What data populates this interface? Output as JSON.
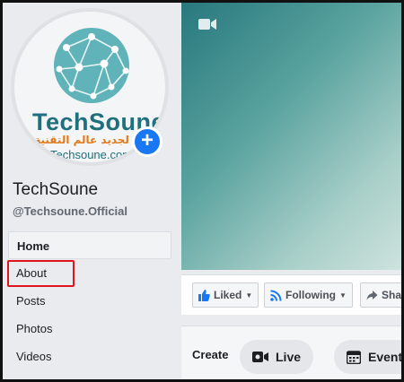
{
  "profile": {
    "logo_text": "TechSoune",
    "logo_tagline": "تك لجديد عالم التقنية",
    "logo_site": "Techsoune.com",
    "add_badge": "+",
    "page_name": "TechSoune",
    "handle": "@Techsoune.Official"
  },
  "sidebar": {
    "items": [
      {
        "label": "Home"
      },
      {
        "label": "About"
      },
      {
        "label": "Posts"
      },
      {
        "label": "Photos"
      },
      {
        "label": "Videos"
      }
    ]
  },
  "cover": {
    "icon": "video-camera-icon"
  },
  "actions": {
    "liked": "Liked",
    "following": "Following",
    "share": "Sha"
  },
  "create": {
    "label": "Create",
    "live": "Live",
    "event": "Event"
  },
  "colors": {
    "accent": "#1877f2",
    "highlight": "#e0141e",
    "brand": "#1f6f7d"
  }
}
